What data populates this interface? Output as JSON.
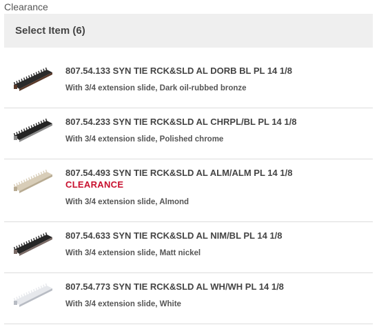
{
  "breadcrumb": "Clearance",
  "header": {
    "title": "Select Item (6)"
  },
  "items": [
    {
      "title": "807.54.133 SYN TIE RCK&SLD AL DORB BL PL 14 1/8",
      "badge": "",
      "description": "With 3/4 extension slide, Dark oil-rubbed bronze",
      "thumb_color": "#2a2a2a",
      "thumb_accent": "#5a3a2a"
    },
    {
      "title": "807.54.233 SYN TIE RCK&SLD AL CHRPL/BL PL 14 1/8",
      "badge": "",
      "description": "With 3/4 extension slide, Polished chrome",
      "thumb_color": "#232323",
      "thumb_accent": "#8a8a8a"
    },
    {
      "title": "807.54.493 SYN TIE RCK&SLD AL ALM/ALM PL 14 1/8",
      "badge": "CLEARANCE",
      "description": "With 3/4 extension slide, Almond",
      "thumb_color": "#d8cdb8",
      "thumb_accent": "#b8ab92"
    },
    {
      "title": "807.54.633 SYN TIE RCK&SLD AL NIM/BL PL 14 1/8",
      "badge": "",
      "description": "With 3/4 extension slide, Matt nickel",
      "thumb_color": "#262626",
      "thumb_accent": "#7a6a66"
    },
    {
      "title": "807.54.773 SYN TIE RCK&SLD AL WH/WH PL 14 1/8",
      "badge": "",
      "description": "With 3/4 extension slide, White",
      "thumb_color": "#e6e8ec",
      "thumb_accent": "#b8bcc4"
    }
  ]
}
